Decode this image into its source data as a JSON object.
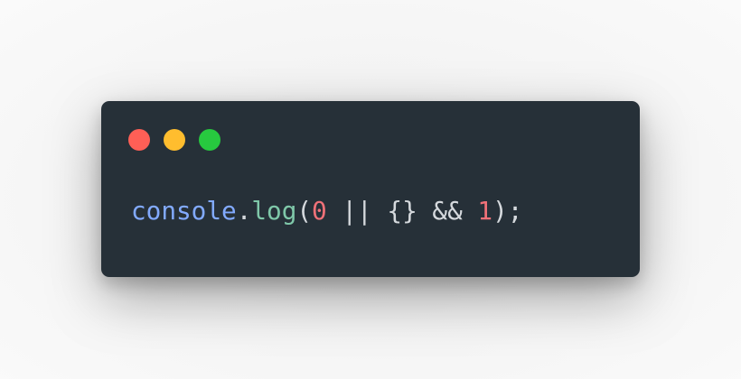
{
  "window": {
    "background": "#263038",
    "buttons": [
      {
        "name": "close",
        "color": "#ff5f56"
      },
      {
        "name": "minimize",
        "color": "#ffbd2e"
      },
      {
        "name": "maximize",
        "color": "#27c93f"
      }
    ]
  },
  "code": {
    "line": [
      {
        "text": "console",
        "role": "object",
        "color": "#82aaff"
      },
      {
        "text": ".",
        "role": "punctuation",
        "color": "#d5d9dd"
      },
      {
        "text": "log",
        "role": "method",
        "color": "#7fc8a9"
      },
      {
        "text": "(",
        "role": "punctuation",
        "color": "#d5d9dd"
      },
      {
        "text": "0",
        "role": "number",
        "color": "#f07178"
      },
      {
        "text": " || {} && ",
        "role": "operator",
        "color": "#d5d9dd"
      },
      {
        "text": "1",
        "role": "number",
        "color": "#f07178"
      },
      {
        "text": ");",
        "role": "punctuation",
        "color": "#d5d9dd"
      }
    ]
  }
}
